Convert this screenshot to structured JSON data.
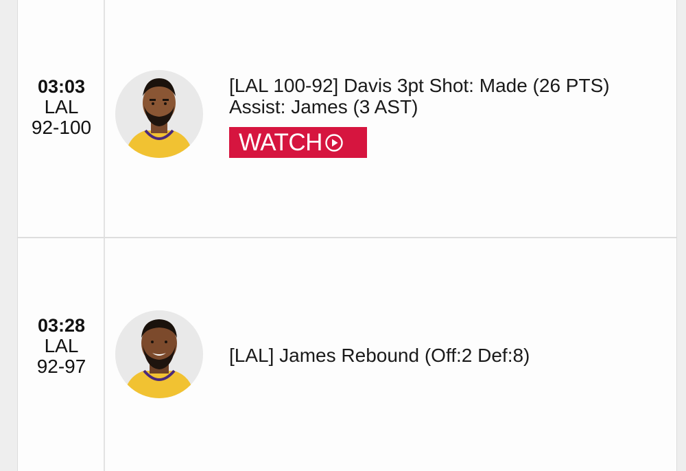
{
  "plays": [
    {
      "clock": "03:03",
      "team": "LAL",
      "score": "92-100",
      "player_icon": "player-headshot-davis",
      "lines": [
        "[LAL 100-92] Davis 3pt Shot: Made (26 PTS)",
        "Assist: James (3 AST)"
      ],
      "watch_label": "WATCH",
      "watch_icon": "play-circle-icon"
    },
    {
      "clock": "03:28",
      "team": "LAL",
      "score": "92-97",
      "player_icon": "player-headshot-james",
      "lines": [
        "[LAL] James Rebound (Off:2 Def:8)"
      ]
    }
  ],
  "colors": {
    "watch_background": "#d6153f",
    "jersey_gold": "#f1c232",
    "avatar_background": "#e9e9e9"
  }
}
